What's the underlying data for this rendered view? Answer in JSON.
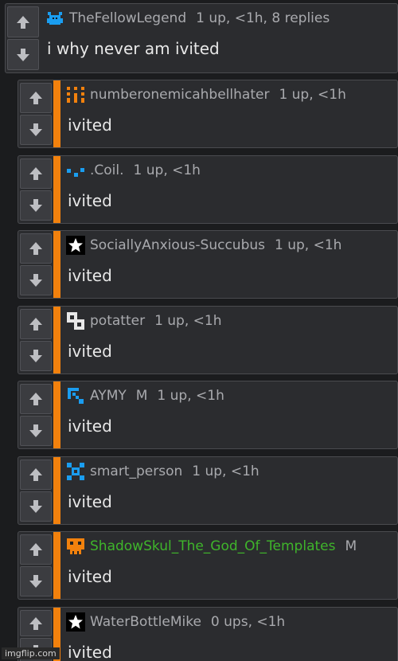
{
  "comments": [
    {
      "username": "TheFellowLegend",
      "badge": "",
      "info": "1 up, <1h, 8 replies",
      "text": "i why never am ivited",
      "avatar": "blue-creature-icon",
      "username_color": "#a9aaae"
    },
    {
      "username": "numberonemicahbellhater",
      "badge": "",
      "info": "1 up, <1h",
      "text": "ivited",
      "avatar": "orange-pattern-icon",
      "username_color": "#a9aaae"
    },
    {
      "username": ".Coil.",
      "badge": "",
      "info": "1 up, <1h",
      "text": "ivited",
      "avatar": "blue-dots-icon",
      "username_color": "#a9aaae"
    },
    {
      "username": "SociallyAnxious-Succubus",
      "badge": "",
      "info": "1 up, <1h",
      "text": "ivited",
      "avatar": "white-star-icon",
      "username_color": "#a9aaae"
    },
    {
      "username": "potatter",
      "badge": "",
      "info": "1 up, <1h",
      "text": "ivited",
      "avatar": "white-block-icon",
      "username_color": "#a9aaae"
    },
    {
      "username": "AYMY",
      "badge": "M",
      "info": "1 up, <1h",
      "text": "ivited",
      "avatar": "blue-pickaxe-icon",
      "username_color": "#a9aaae"
    },
    {
      "username": "smart_person",
      "badge": "",
      "info": "1 up, <1h",
      "text": "ivited",
      "avatar": "blue-x-pattern-icon",
      "username_color": "#a9aaae"
    },
    {
      "username": "ShadowSkul_The_God_Of_Templates",
      "badge": "M",
      "info": "",
      "text": "ivited",
      "avatar": "orange-skull-icon",
      "username_color": "#3fb52b"
    },
    {
      "username": "WaterBottleMike",
      "badge": "",
      "info": "0 ups, <1h",
      "text": "ivited",
      "avatar": "white-star-icon",
      "username_color": "#a9aaae"
    }
  ],
  "colors": {
    "reply_stripe": "#f2810d",
    "background": "#1b1c1e",
    "panel": "#2b2c2f"
  },
  "watermark": "imgflip.com"
}
